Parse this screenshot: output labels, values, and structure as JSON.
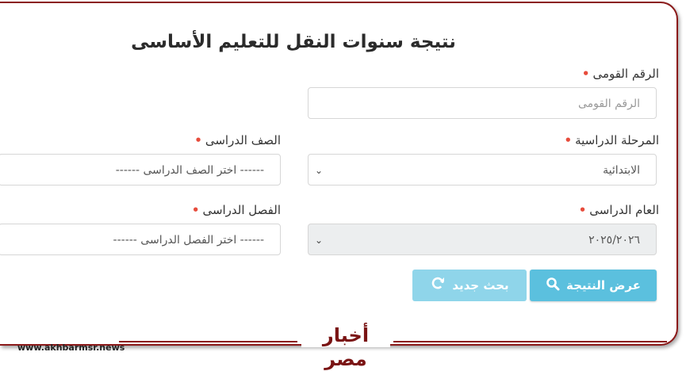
{
  "form": {
    "title": "نتيجة سنوات النقل للتعليم الأساسى",
    "national_id": {
      "label": "الرقم القومى",
      "placeholder": "الرقم القومى"
    },
    "stage": {
      "label": "المرحلة الدراسية",
      "value": "الابتدائية"
    },
    "grade": {
      "label": "الصف الدراسى",
      "value": "------ اختر الصف الدراسى ------"
    },
    "year": {
      "label": "العام الدراسى",
      "value": "٢٠٢٥/٢٠٢٦"
    },
    "semester": {
      "label": "الفصل الدراسى",
      "value": "------ اختر الفصل الدراسى ------"
    },
    "required_mark": "•"
  },
  "buttons": {
    "show_result": "عرض النتيجة",
    "new_search": "بحث جديد"
  },
  "icons": {
    "search": "search-icon",
    "refresh": "refresh-icon",
    "dropdown": "chevron-down-icon"
  },
  "watermark": {
    "brand": "أخبار مصر",
    "url": "www.akhbarmsr.news"
  },
  "colors": {
    "accent": "#5bc0de",
    "required": "#e74c3c",
    "frame": "#8b1a1a"
  }
}
